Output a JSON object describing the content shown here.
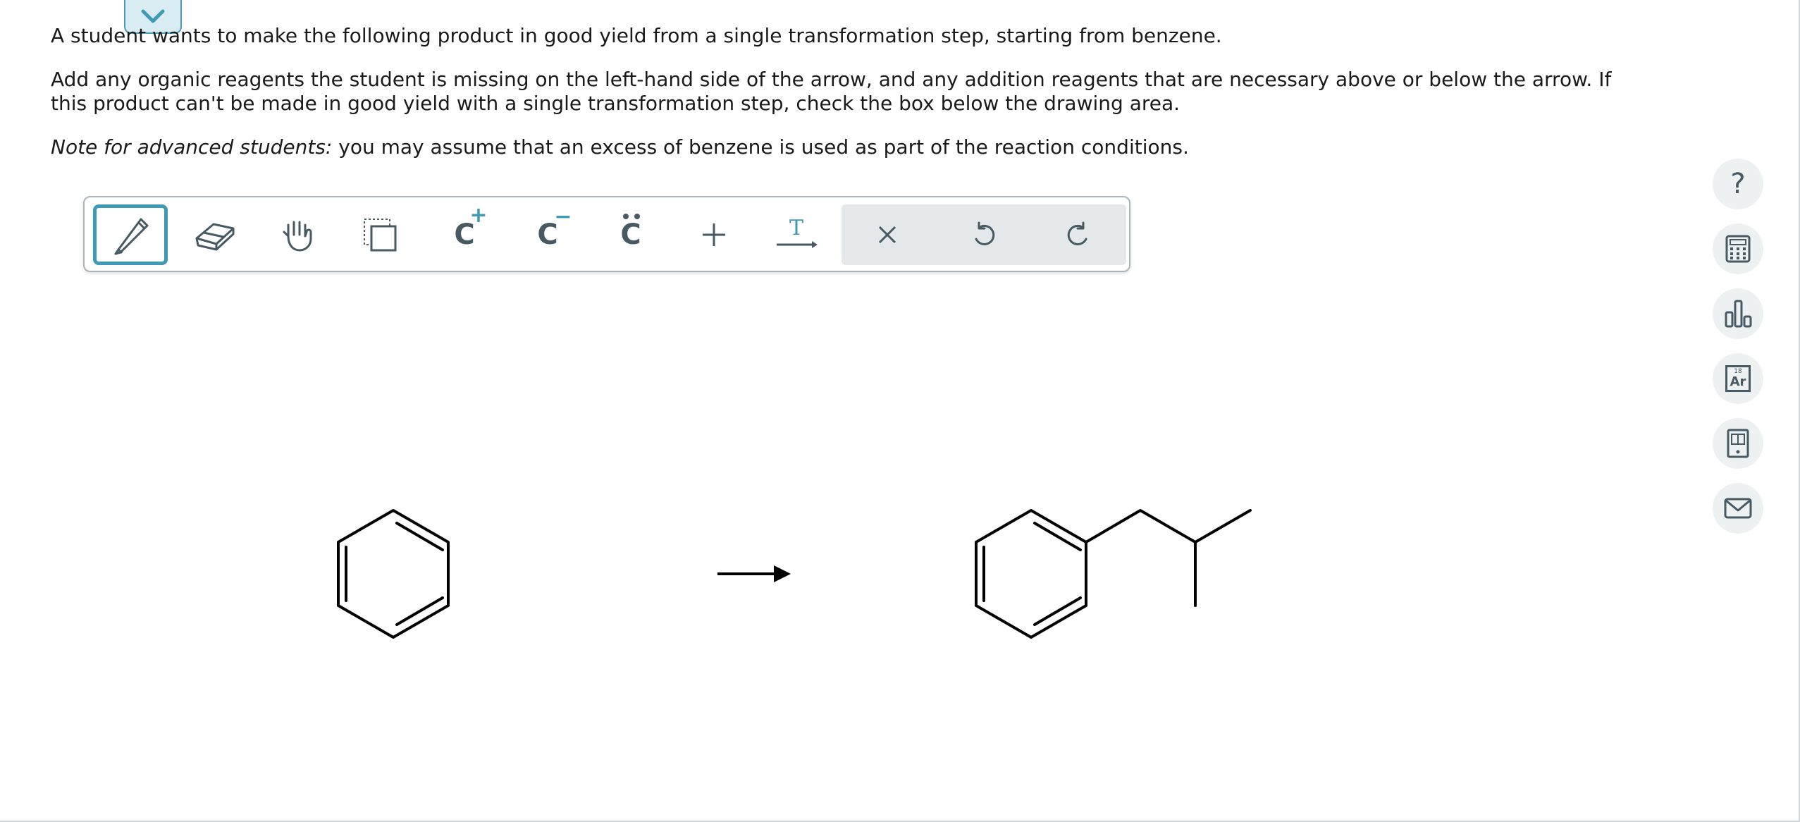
{
  "question": {
    "paragraph1": "A student wants to make the following product in good yield from a single transformation step, starting from benzene.",
    "paragraph2": "Add any organic reagents the student is missing on the left-hand side of the arrow, and any addition reagents that are necessary above or below the arrow. If this product can't be made in good yield with a single transformation step, check the box below the drawing area.",
    "note_label": "Note for advanced students:",
    "note_text": " you may assume that an excess of benzene is used as part of the reaction conditions."
  },
  "toolbar": {
    "tools": [
      "pencil-icon",
      "eraser-icon",
      "hand-icon",
      "select-icon",
      "positive-charge-icon",
      "negative-charge-icon",
      "lone-pair-icon",
      "plus-icon",
      "text-arrow-icon",
      "clear-icon",
      "undo-icon",
      "redo-icon"
    ],
    "charge_letter": "C",
    "plus_sign": "+",
    "minus_sign": "−",
    "text_letter": "T"
  },
  "sidebar": {
    "help_glyph": "?",
    "periodic_number": "18",
    "periodic_symbol": "Ar",
    "icons": [
      "help-icon",
      "calculator-icon",
      "chart-icon",
      "periodic-table-icon",
      "textbook-icon",
      "mail-icon"
    ]
  },
  "colors": {
    "accent": "#3f9ab3",
    "icon": "#475a63",
    "tab_bg": "#d9ecf2"
  }
}
